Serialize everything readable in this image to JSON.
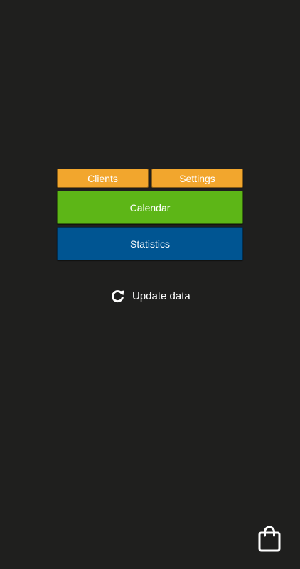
{
  "menu": {
    "clients_label": "Clients",
    "settings_label": "Settings",
    "calendar_label": "Calendar",
    "statistics_label": "Statistics"
  },
  "actions": {
    "update_label": "Update data"
  },
  "icons": {
    "update": "refresh-icon",
    "store": "shopping-bag-icon"
  },
  "colors": {
    "background": "#1f1f1e",
    "clients_settings": "#f2a62d",
    "calendar": "#5db617",
    "statistics": "#005592"
  }
}
